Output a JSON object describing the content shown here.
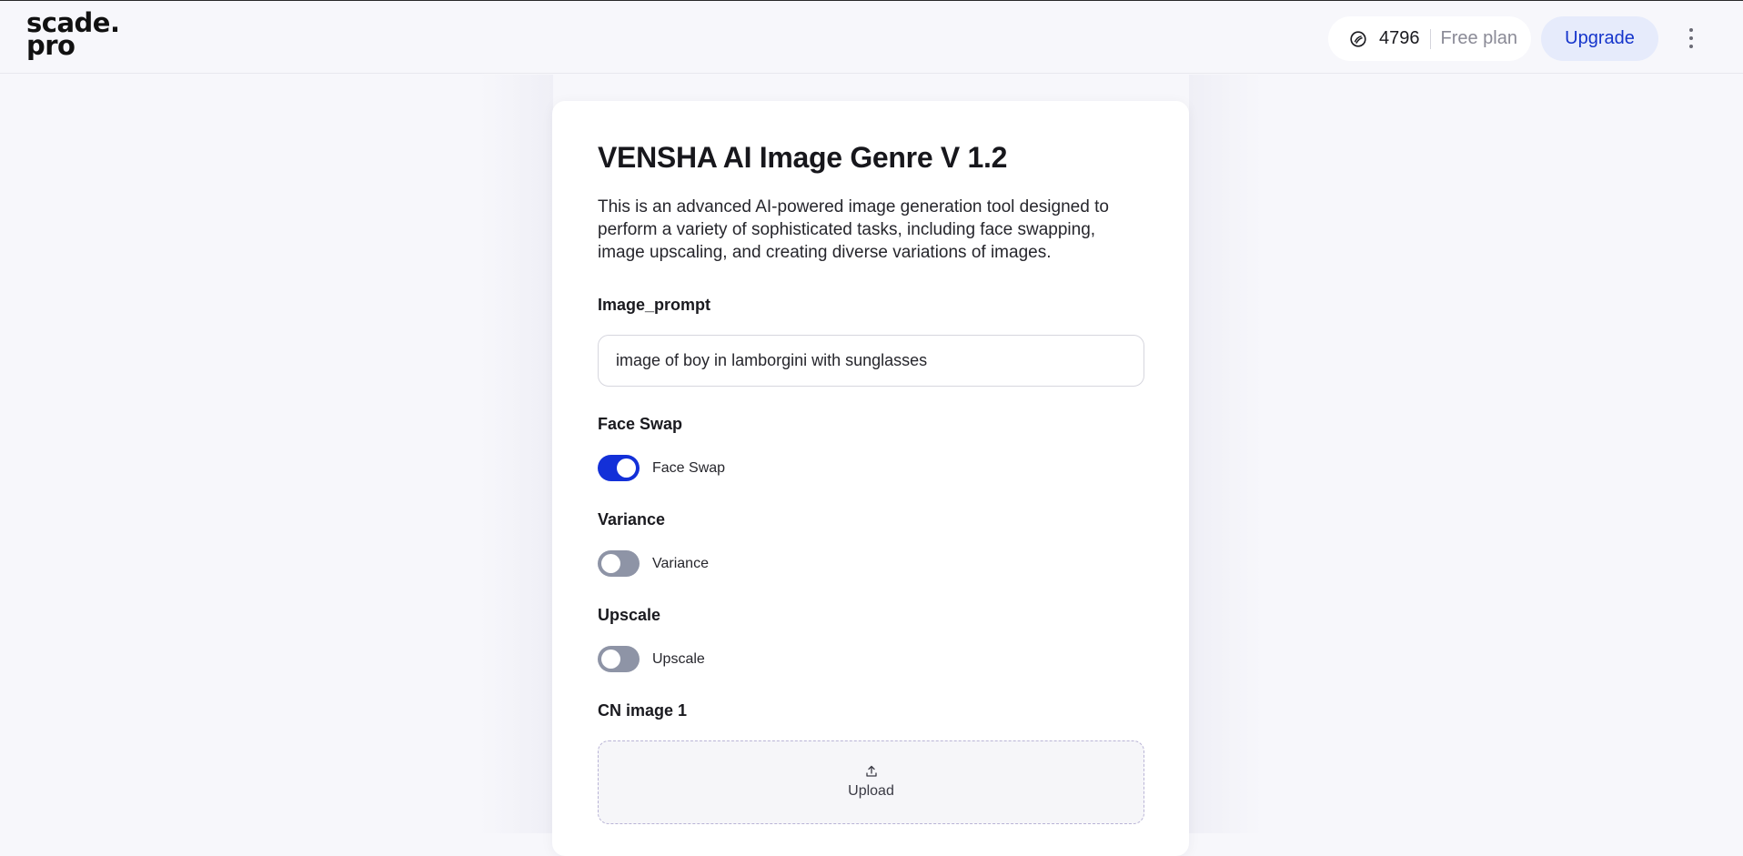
{
  "header": {
    "logo_line1": "scade.",
    "logo_line2": "pro",
    "credits_count": "4796",
    "plan_label": "Free plan",
    "upgrade_label": "Upgrade"
  },
  "form": {
    "title": "VENSHA AI Image Genre V 1.2",
    "description": "This is an advanced AI-powered image generation tool designed to perform a variety of sophisticated tasks, including face swapping, image upscaling, and creating diverse variations of images.",
    "image_prompt_label": "Image_prompt",
    "image_prompt_value": "image of boy in lamborgini with sunglasses",
    "face_swap": {
      "label": "Face Swap",
      "toggle_text": "Face Swap",
      "on": true
    },
    "variance": {
      "label": "Variance",
      "toggle_text": "Variance",
      "on": false
    },
    "upscale": {
      "label": "Upscale",
      "toggle_text": "Upscale",
      "on": false
    },
    "cn_image_label": "CN image 1",
    "upload_label": "Upload"
  },
  "colors": {
    "accent": "#1330d8",
    "toggle_off": "#8e94a6",
    "upgrade_bg": "#e6ebfb"
  },
  "icons": {
    "credits": "coin-icon",
    "menu": "kebab-menu-icon",
    "upload": "upload-icon"
  }
}
